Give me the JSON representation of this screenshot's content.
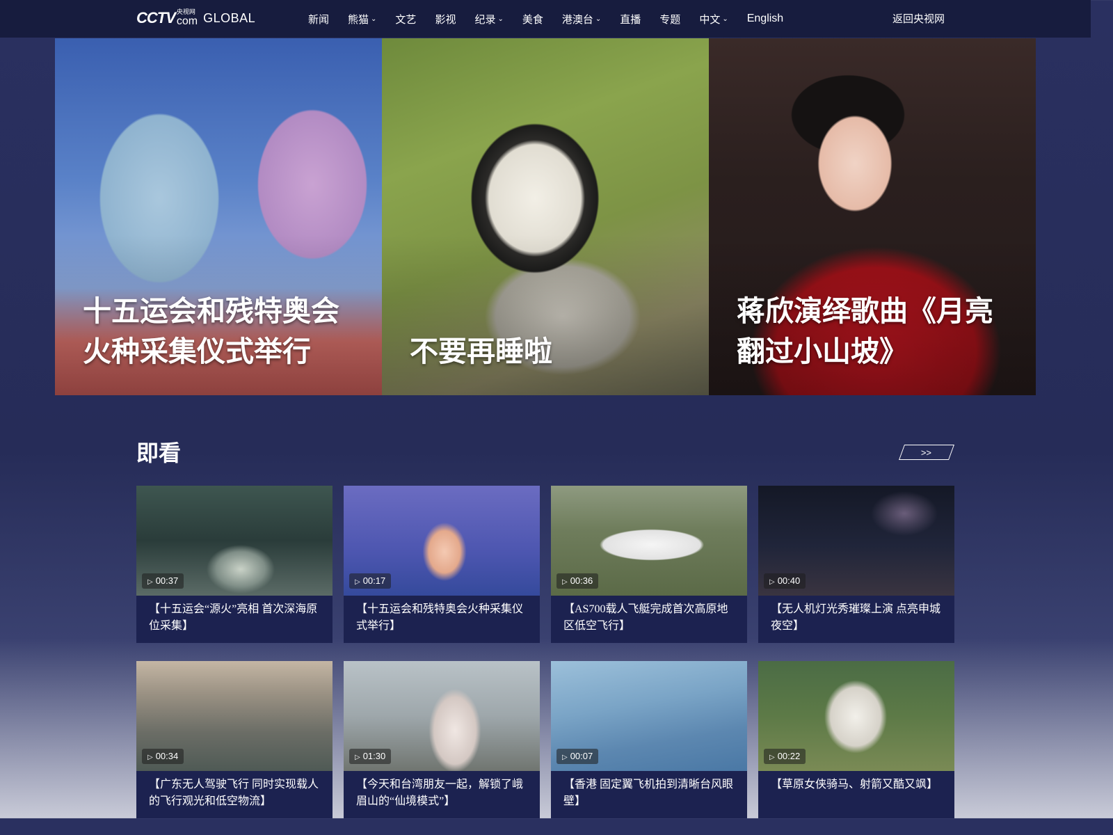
{
  "header": {
    "logo_text": "CCTV",
    "logo_sub_cn": "央视网",
    "logo_sub_com": "com",
    "logo_global": "GLOBAL",
    "nav": [
      {
        "label": "新闻",
        "has_dropdown": false
      },
      {
        "label": "熊猫",
        "has_dropdown": true
      },
      {
        "label": "文艺",
        "has_dropdown": false
      },
      {
        "label": "影视",
        "has_dropdown": false
      },
      {
        "label": "纪录",
        "has_dropdown": true
      },
      {
        "label": "美食",
        "has_dropdown": false
      },
      {
        "label": "港澳台",
        "has_dropdown": true
      },
      {
        "label": "直播",
        "has_dropdown": false
      },
      {
        "label": "专题",
        "has_dropdown": false
      },
      {
        "label": "中文",
        "has_dropdown": true
      },
      {
        "label": "English",
        "has_dropdown": false
      }
    ],
    "back_link": "返回央视网"
  },
  "hero": [
    {
      "title": "十五运会和残特奥会火种采集仪式举行"
    },
    {
      "title": "不要再睡啦"
    },
    {
      "title": "蒋欣演绎歌曲《月亮翻过小山坡》"
    }
  ],
  "section": {
    "title": "即看",
    "more_label": ">>"
  },
  "videos": [
    {
      "duration": "00:37",
      "caption": "【十五运会“源火”亮相 首次深海原位采集】"
    },
    {
      "duration": "00:17",
      "caption": "【十五运会和残特奥会火种采集仪式举行】"
    },
    {
      "duration": "00:36",
      "caption": "【AS700载人飞艇完成首次高原地区低空飞行】"
    },
    {
      "duration": "00:40",
      "caption": "【无人机灯光秀璀璨上演 点亮申城夜空】"
    },
    {
      "duration": "00:34",
      "caption": "【广东无人驾驶飞行 同时实现载人的飞行观光和低空物流】"
    },
    {
      "duration": "01:30",
      "caption": "【今天和台湾朋友一起，解锁了峨眉山的“仙境模式”】"
    },
    {
      "duration": "00:07",
      "caption": "【香港 固定翼飞机拍到清晰台风眼壁】"
    },
    {
      "duration": "00:22",
      "caption": "【草原女侠骑马、射箭又酷又飒】"
    }
  ],
  "icons": {
    "chevron": "chevron-down-icon",
    "play": "play-icon"
  }
}
